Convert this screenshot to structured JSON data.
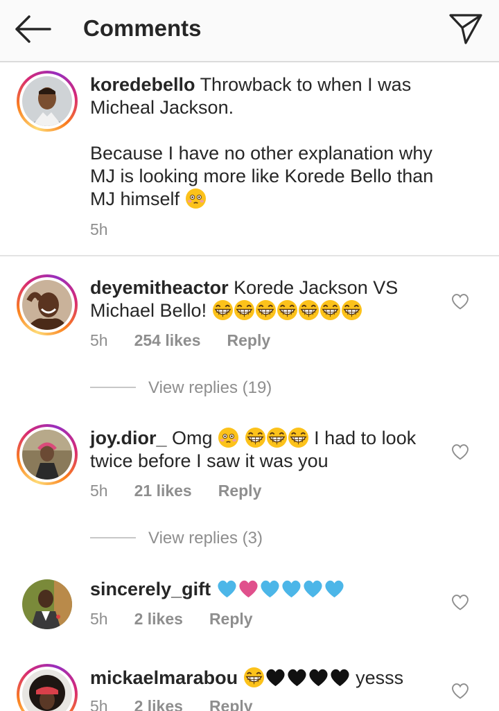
{
  "header": {
    "back_icon": "arrow-left-icon",
    "title": "Comments",
    "share_icon": "paper-plane-icon"
  },
  "caption": {
    "username": "koredebello",
    "text_line1": "Throwback to when I was Micheal Jackson.",
    "text_line2": "Because I have no other explanation why MJ is looking more like Korede Bello than MJ himself",
    "time": "5h"
  },
  "comments": [
    {
      "username": "deyemitheactor",
      "text": "Korede Jackson VS Michael Bello!",
      "time": "5h",
      "likes": "254 likes",
      "reply": "Reply",
      "view_replies": "View replies (19)"
    },
    {
      "username": "joy.dior_",
      "text_a": "Omg",
      "text_b": "I had to look twice before I saw it was you",
      "time": "5h",
      "likes": "21 likes",
      "reply": "Reply",
      "view_replies": "View replies (3)"
    },
    {
      "username": "sincerely_gift",
      "time": "5h",
      "likes": "2 likes",
      "reply": "Reply"
    },
    {
      "username": "mickaelmarabou",
      "text": "yesss",
      "time": "5h",
      "likes": "2 likes",
      "reply": "Reply"
    }
  ],
  "colors": {
    "blue_heart": "#4cb6e8",
    "pink_heart": "#e0508c",
    "story_ring": "#d62976"
  }
}
